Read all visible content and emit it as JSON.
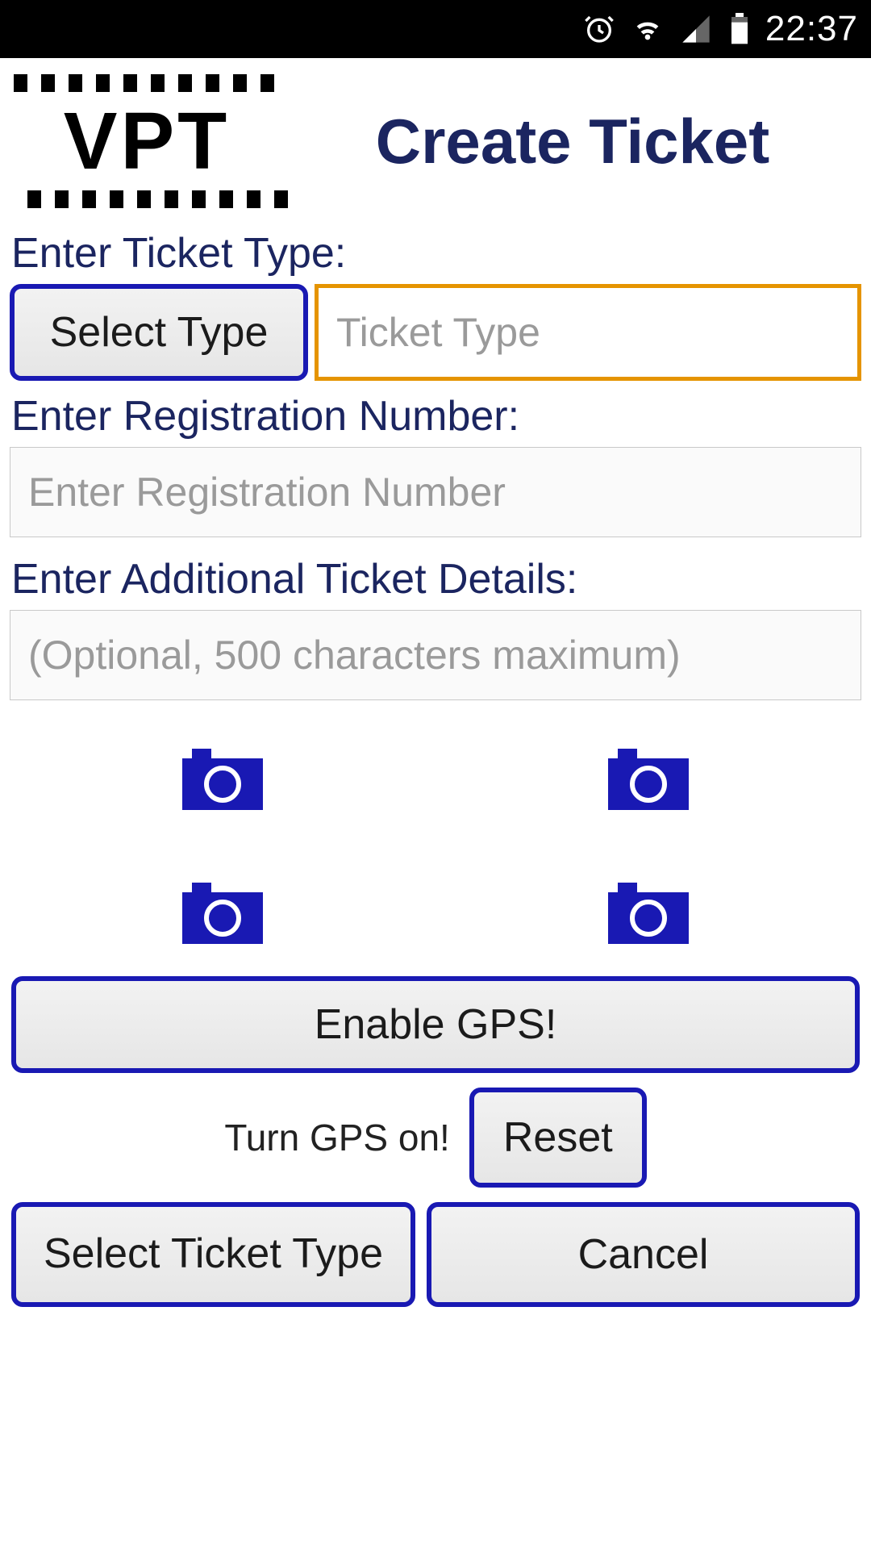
{
  "status": {
    "time": "22:37"
  },
  "header": {
    "logo_text": "VPT",
    "title": "Create Ticket"
  },
  "labels": {
    "ticket_type": "Enter Ticket Type:",
    "registration": "Enter Registration Number:",
    "details": "Enter Additional Ticket Details:"
  },
  "inputs": {
    "select_type_btn": "Select Type",
    "ticket_type_placeholder": "Ticket Type",
    "registration_placeholder": "Enter Registration Number",
    "details_placeholder": "(Optional, 500 characters maximum)"
  },
  "buttons": {
    "enable_gps": "Enable GPS!",
    "reset": "Reset",
    "select_ticket_type": "Select Ticket Type",
    "cancel": "Cancel"
  },
  "gps_text": "Turn GPS on!"
}
